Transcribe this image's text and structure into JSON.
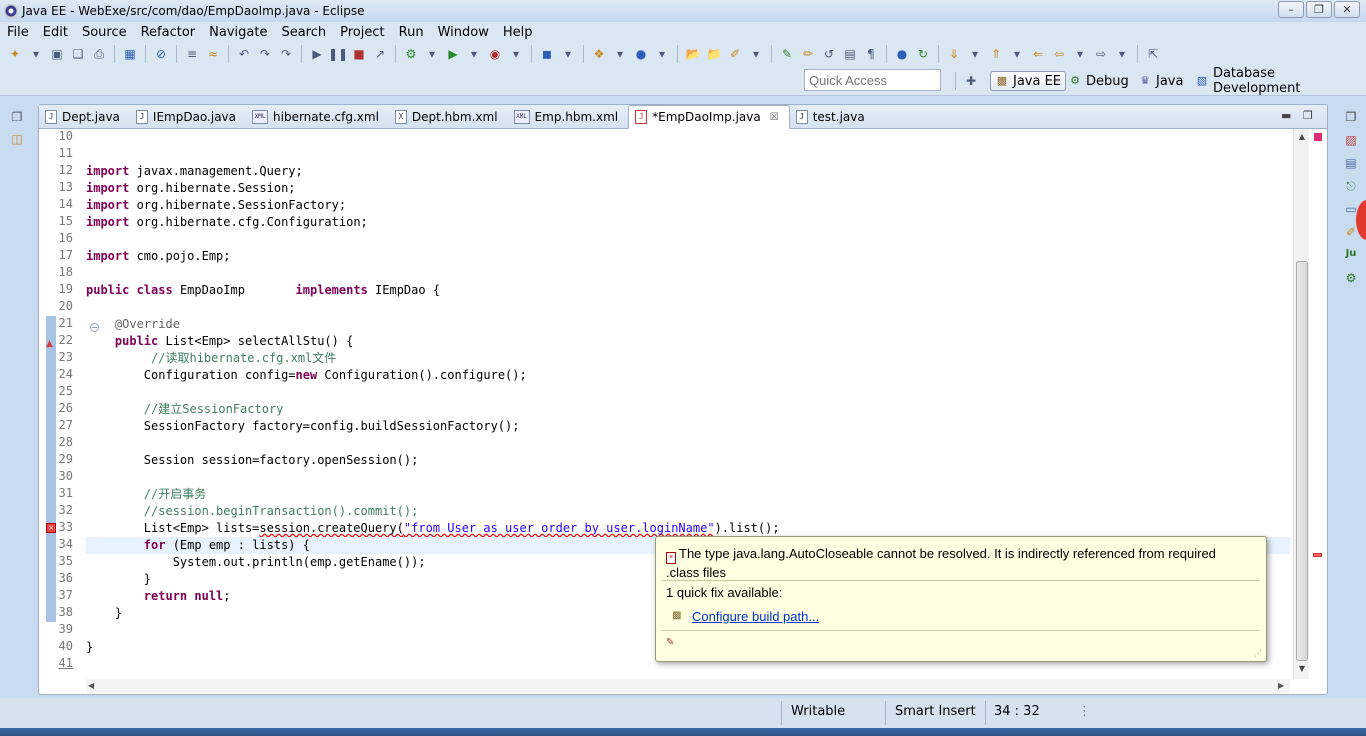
{
  "window": {
    "title": "Java EE - WebExe/src/com/dao/EmpDaoImp.java - Eclipse"
  },
  "menu": [
    "File",
    "Edit",
    "Source",
    "Refactor",
    "Navigate",
    "Search",
    "Project",
    "Run",
    "Window",
    "Help"
  ],
  "quick_access": {
    "placeholder": "Quick Access"
  },
  "perspectives": [
    {
      "label": "Java EE",
      "active": true
    },
    {
      "label": "Debug",
      "active": false
    },
    {
      "label": "Java",
      "active": false
    },
    {
      "label": "Database Development",
      "active": false
    }
  ],
  "tabs": [
    {
      "label": "Dept.java",
      "type": "java",
      "active": false
    },
    {
      "label": "IEmpDao.java",
      "type": "java",
      "active": false
    },
    {
      "label": "hibernate.cfg.xml",
      "type": "xml",
      "active": false
    },
    {
      "label": "Dept.hbm.xml",
      "type": "x",
      "active": false
    },
    {
      "label": "Emp.hbm.xml",
      "type": "xml",
      "active": false
    },
    {
      "label": "*EmpDaoImp.java",
      "type": "java",
      "active": true
    },
    {
      "label": "test.java",
      "type": "java",
      "active": false
    }
  ],
  "line_numbers": [
    "10",
    "11",
    "12",
    "13",
    "14",
    "15",
    "16",
    "17",
    "18",
    "19",
    "20",
    "21",
    "22",
    "23",
    "24",
    "25",
    "26",
    "27",
    "28",
    "29",
    "30",
    "31",
    "32",
    "33",
    "34",
    "35",
    "36",
    "37",
    "38",
    "39",
    "40",
    "41"
  ],
  "code": {
    "l12_imp": "import",
    "l12_rest": " javax.management.Query;",
    "l13_imp": "import",
    "l13_rest": " org.hibernate.Session;",
    "l14_imp": "import",
    "l14_rest": " org.hibernate.SessionFactory;",
    "l15_imp": "import",
    "l15_rest": " org.hibernate.cfg.Configuration;",
    "l17_imp": "import",
    "l17_rest": " cmo.pojo.Emp;",
    "l19_kw1": "public",
    "l19_kw2": " class",
    "l19_name": " EmpDaoImp       ",
    "l19_kw3": "implements",
    "l19_rest": " IEmpDao {",
    "l21": "    @Override",
    "l22_kw": "    public",
    "l22_rest": " List<Emp> selectAllStu() {",
    "l23": "         //读取hibernate.cfg.xml文件",
    "l24_a": "        Configuration config=",
    "l24_kw": "new",
    "l24_b": " Configuration().configure();",
    "l26": "        //建立SessionFactory",
    "l27": "        SessionFactory factory=config.buildSessionFactory();",
    "l29": "        Session session=factory.openSession();",
    "l31": "        //开启事务",
    "l32": "        //session.beginTransaction().commit();",
    "l33_a": "        List<Emp> lists=",
    "l33_err": "session.createQuery(",
    "l33_str": "\"from User as user order by user.loginName\"",
    "l33_b": ").list();",
    "l34_kw": "        for",
    "l34_rest": " (Emp emp : lists) {",
    "l35": "            System.out.println(emp.getEname());",
    "l36": "        }",
    "l37_kw": "        return",
    "l37_kw2": " null",
    "l37_rest": ";",
    "l38": "    }",
    "l40": "}"
  },
  "hover": {
    "message": "The type java.lang.AutoCloseable cannot be resolved. It is indirectly referenced from required .class files",
    "fixes_count": "1 quick fix available:",
    "fix_label": "Configure build path..."
  },
  "status": {
    "writable": "Writable",
    "insert_mode": "Smart Insert",
    "position": "34 : 32"
  }
}
